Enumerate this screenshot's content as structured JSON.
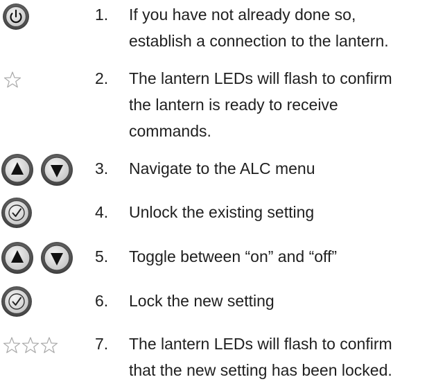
{
  "steps": [
    {
      "number": "1.",
      "lines": [
        "If you have not already done so,",
        "establish a connection to the lantern."
      ],
      "icon": "power-button-icon"
    },
    {
      "number": "2.",
      "lines": [
        "The lantern LEDs will flash to confirm",
        "the lantern is ready to receive",
        "commands."
      ],
      "icon": "star-icon"
    },
    {
      "number": "3.",
      "lines": [
        "Navigate to the ALC menu"
      ],
      "icon": "up-down-buttons-icon"
    },
    {
      "number": "4.",
      "lines": [
        "Unlock the existing setting"
      ],
      "icon": "check-button-icon"
    },
    {
      "number": "5.",
      "lines": [
        "Toggle between “on” and “off”"
      ],
      "icon": "up-down-buttons-icon"
    },
    {
      "number": "6.",
      "lines": [
        "Lock the new setting"
      ],
      "icon": "check-button-icon"
    },
    {
      "number": "7.",
      "lines": [
        "The lantern LEDs will flash to confirm",
        "that the new setting has been locked."
      ],
      "icon": "three-stars-icon"
    }
  ],
  "colors": {
    "text": "#1f1f1f",
    "button_bezel": "#5a5a5a",
    "button_face": "#d8d8d8",
    "star_outline": "#a8a8a8"
  }
}
